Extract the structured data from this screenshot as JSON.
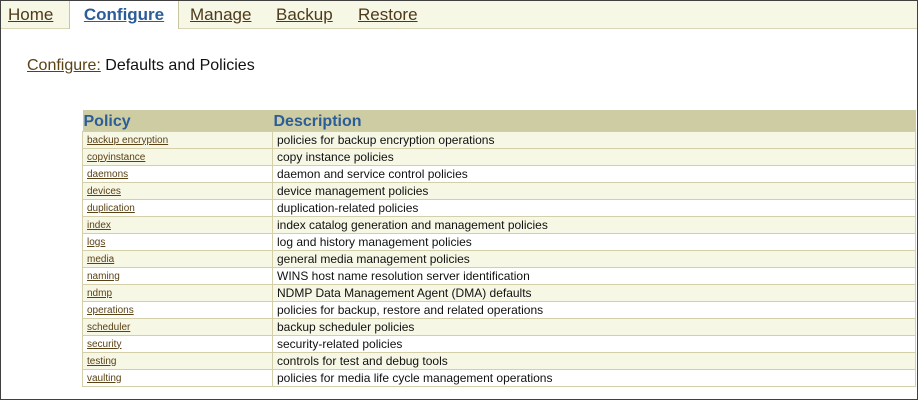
{
  "tabs": [
    {
      "label": "Home"
    },
    {
      "label": "Configure",
      "active": true
    },
    {
      "label": "Manage"
    },
    {
      "label": "Backup"
    },
    {
      "label": "Restore"
    }
  ],
  "heading": {
    "crumb": "Configure:",
    "title": "Defaults and Policies"
  },
  "table": {
    "headers": {
      "policy": "Policy",
      "description": "Description"
    },
    "rows": [
      {
        "name": "backup encryption",
        "desc": "policies for backup encryption operations"
      },
      {
        "name": "copyinstance",
        "desc": "copy instance policies"
      },
      {
        "name": "daemons",
        "desc": "daemon and service control policies"
      },
      {
        "name": "devices",
        "desc": "device management policies"
      },
      {
        "name": "duplication",
        "desc": "duplication-related policies"
      },
      {
        "name": "index",
        "desc": "index catalog generation and management policies"
      },
      {
        "name": "logs",
        "desc": "log and history management policies"
      },
      {
        "name": "media",
        "desc": "general media management policies"
      },
      {
        "name": "naming",
        "desc": "WINS host name resolution server identification"
      },
      {
        "name": "ndmp",
        "desc": "NDMP Data Management Agent (DMA) defaults"
      },
      {
        "name": "operations",
        "desc": "policies for backup, restore and related operations"
      },
      {
        "name": "scheduler",
        "desc": "backup scheduler policies"
      },
      {
        "name": "security",
        "desc": "security-related policies"
      },
      {
        "name": "testing",
        "desc": "controls for test and debug tools"
      },
      {
        "name": "vaulting",
        "desc": "policies for media life cycle management operations"
      }
    ]
  },
  "colors": {
    "header_bg": "#cdcca2",
    "header_text": "#2b5d99",
    "link": "#5a4215",
    "alt_row": "#f7f7e6"
  }
}
